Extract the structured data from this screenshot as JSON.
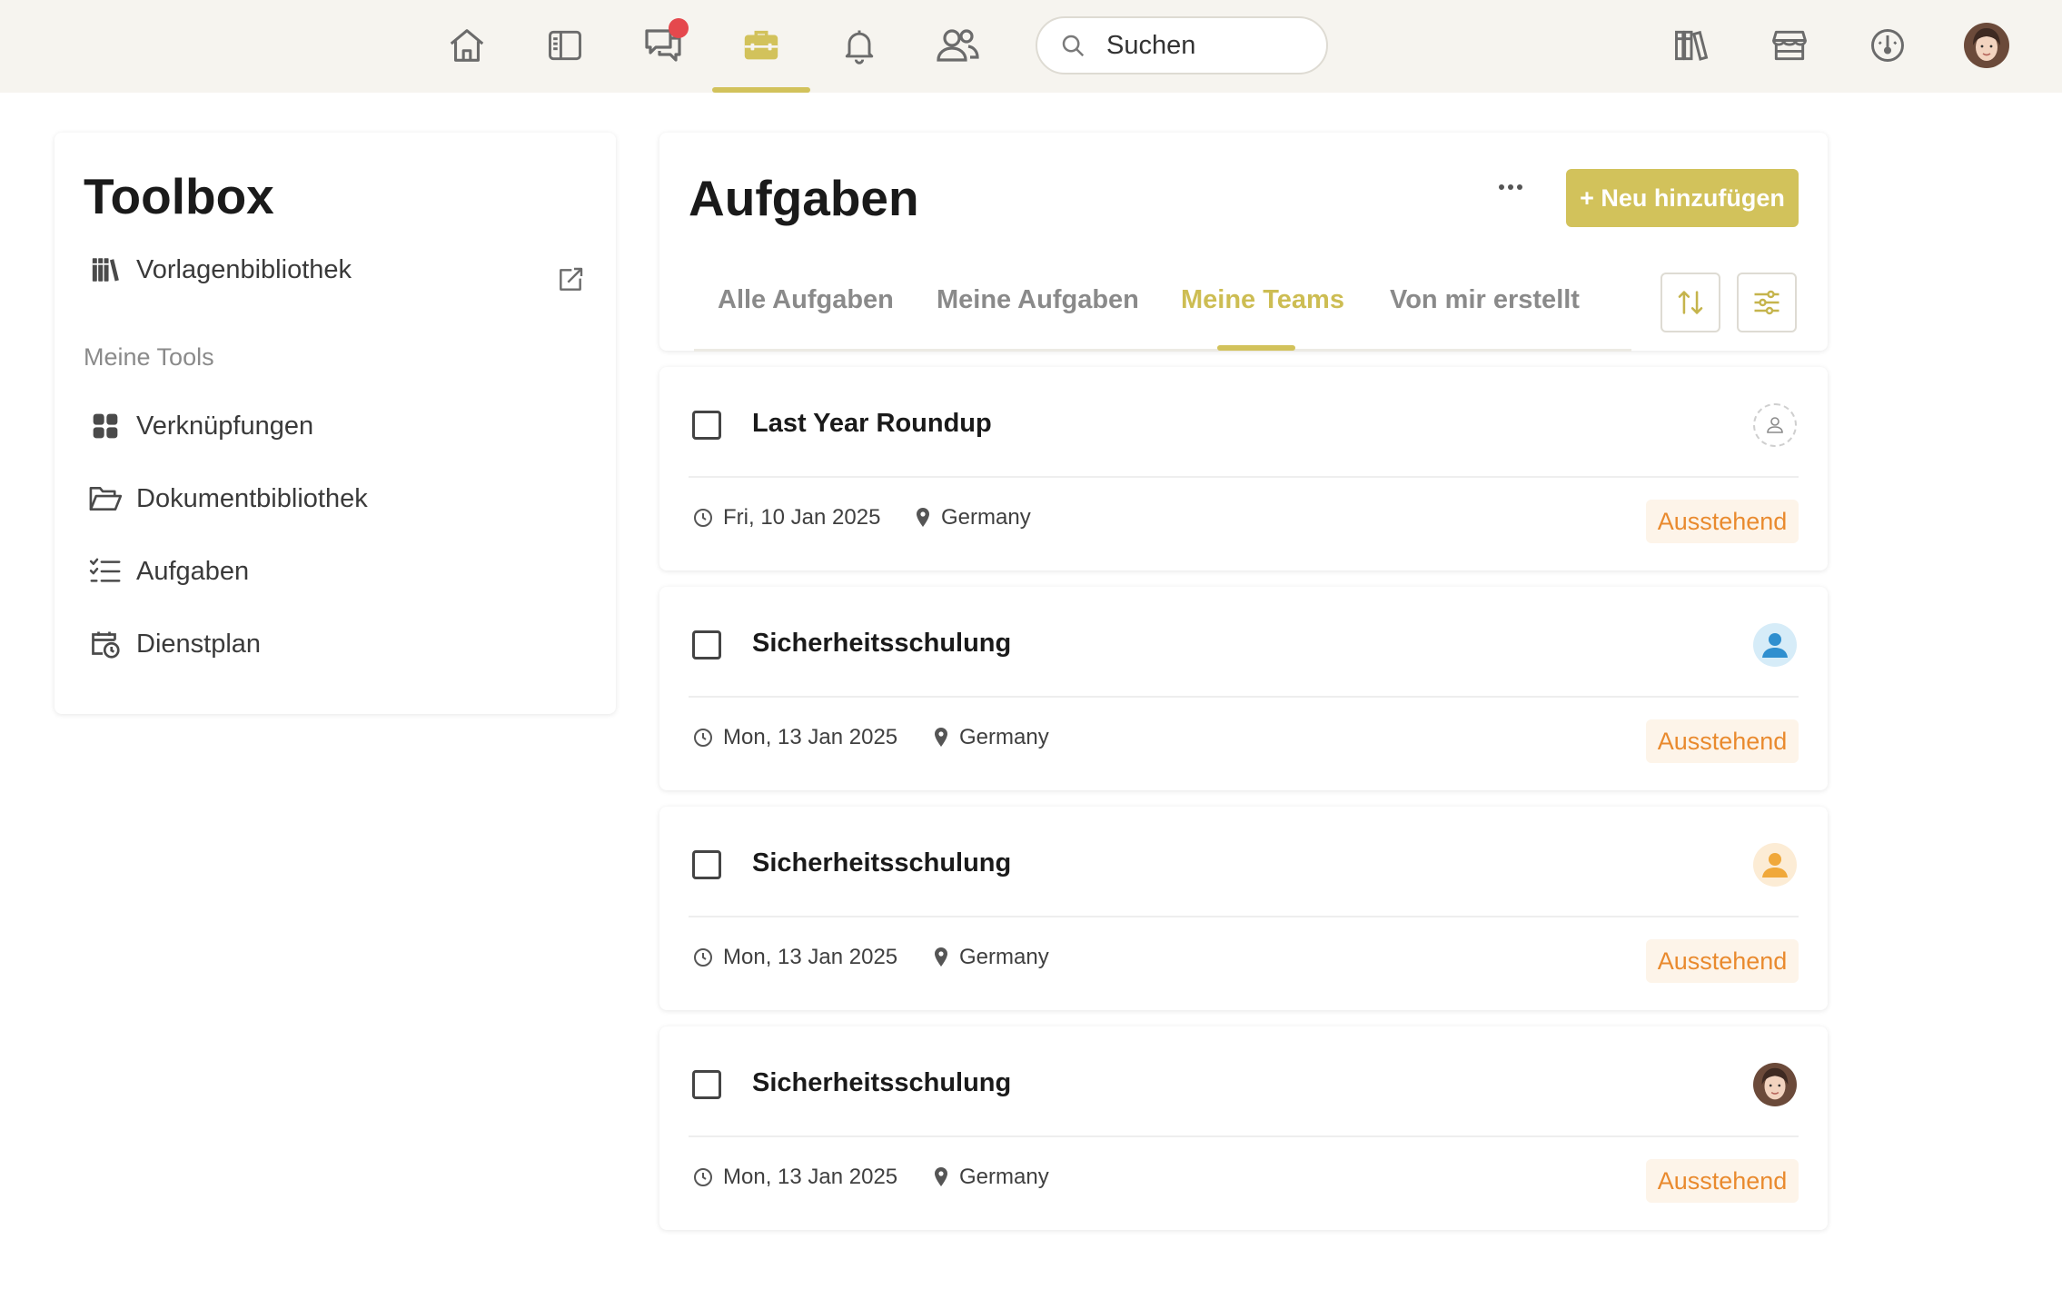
{
  "topbar": {
    "nav_icons": [
      "home-icon",
      "sidebar-panel-icon",
      "chat-icon",
      "briefcase-icon",
      "bell-icon",
      "users-icon"
    ],
    "active_nav": "briefcase-icon",
    "search_placeholder": "Suchen",
    "right_icons": [
      "library-icon",
      "store-icon",
      "dashboard-icon"
    ]
  },
  "toolbox": {
    "title": "Toolbox",
    "template_library": "Vorlagenbibliothek",
    "section_label": "Meine Tools",
    "tools": [
      {
        "label": "Verknüpfungen",
        "icon": "grid-icon"
      },
      {
        "label": "Dokumentbibliothek",
        "icon": "folder-open-icon"
      },
      {
        "label": "Aufgaben",
        "icon": "checklist-icon"
      },
      {
        "label": "Dienstplan",
        "icon": "calendar-clock-icon"
      }
    ]
  },
  "main": {
    "title": "Aufgaben",
    "add_button": "+ Neu hinzufügen",
    "tabs": [
      "Alle Aufgaben",
      "Meine Aufgaben",
      "Meine Teams",
      "Von mir erstellt"
    ],
    "active_tab": "Meine Teams"
  },
  "tasks": [
    {
      "title": "Last Year Roundup",
      "date": "Fri, 10 Jan 2025",
      "location": "Germany",
      "status": "Ausstehend",
      "assignee": "empty"
    },
    {
      "title": "Sicherheitsschulung",
      "date": "Mon, 13 Jan 2025",
      "location": "Germany",
      "status": "Ausstehend",
      "assignee": "blue-user"
    },
    {
      "title": "Sicherheitsschulung",
      "date": "Mon, 13 Jan 2025",
      "location": "Germany",
      "status": "Ausstehend",
      "assignee": "orange-user"
    },
    {
      "title": "Sicherheitsschulung",
      "date": "Mon, 13 Jan 2025",
      "location": "Germany",
      "status": "Ausstehend",
      "assignee": "photo"
    }
  ],
  "colors": {
    "accent": "#d2c25b",
    "status_text": "#e98a2e",
    "status_bg": "#fdf4e9",
    "notification": "#e5484d"
  }
}
